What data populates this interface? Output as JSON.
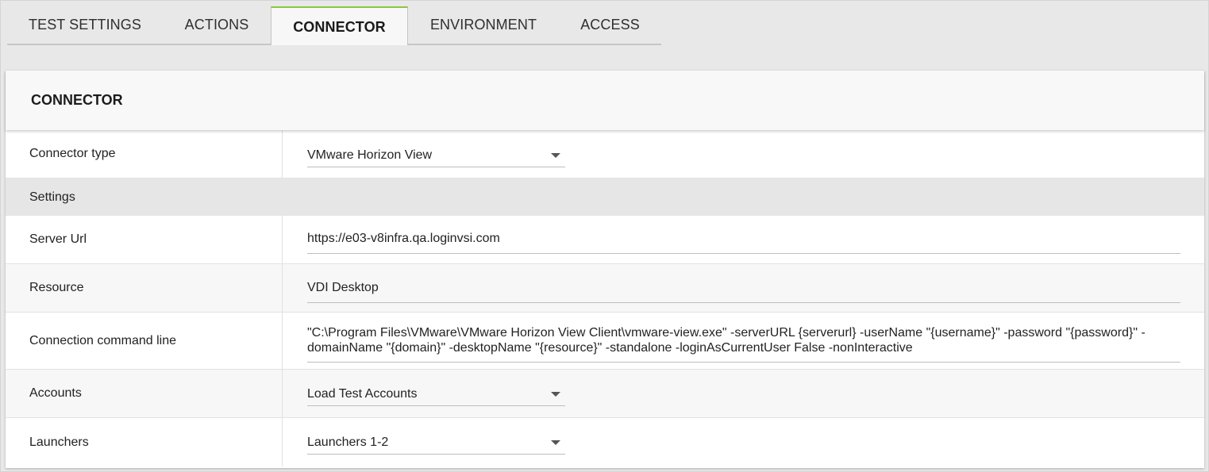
{
  "tabs": [
    {
      "label": "TEST SETTINGS",
      "active": false
    },
    {
      "label": "ACTIONS",
      "active": false
    },
    {
      "label": "CONNECTOR",
      "active": true
    },
    {
      "label": "ENVIRONMENT",
      "active": false
    },
    {
      "label": "ACCESS",
      "active": false
    }
  ],
  "panel": {
    "title": "CONNECTOR",
    "connector_type": {
      "label": "Connector type",
      "value": "VMware Horizon View"
    },
    "settings_section": "Settings",
    "server_url": {
      "label": "Server Url",
      "value": "https://e03-v8infra.qa.loginvsi.com"
    },
    "resource": {
      "label": "Resource",
      "value": "VDI Desktop"
    },
    "command_line": {
      "label": "Connection command line",
      "line1": "\"C:\\Program Files\\VMware\\VMware Horizon View Client\\vmware-view.exe\" -serverURL {serverurl} -userName \"{username}\" -password \"{password}\" -",
      "line2": "domainName \"{domain}\" -desktopName \"{resource}\" -standalone -loginAsCurrentUser False -nonInteractive"
    },
    "accounts": {
      "label": "Accounts",
      "value": "Load Test Accounts"
    },
    "launchers": {
      "label": "Launchers",
      "value": "Launchers 1-2"
    }
  },
  "colors": {
    "active_tab_accent": "#8cc63f",
    "background": "#e8e8e8",
    "section_header": "#e6e6e6"
  }
}
